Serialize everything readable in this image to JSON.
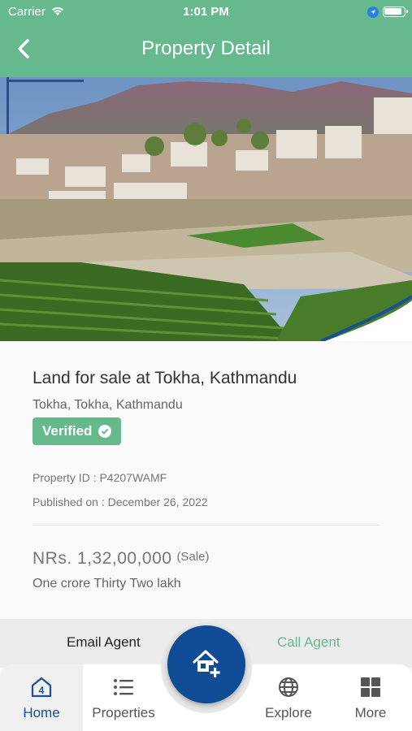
{
  "status_bar": {
    "carrier": "Carrier",
    "time": "1:01 PM"
  },
  "nav": {
    "title": "Property Detail"
  },
  "property": {
    "title": "Land for sale at Tokha, Kathmandu",
    "address": "Tokha, Tokha, Kathmandu",
    "verified_label": "Verified",
    "property_id": "Property ID : P4207WAMF",
    "published": "Published on : December 26, 2022",
    "price": "NRs. 1,32,00,000",
    "price_type": "(Sale)",
    "price_words": "One crore Thirty Two lakh"
  },
  "actions": {
    "email": "Email Agent",
    "call": "Call Agent"
  },
  "tabs": [
    {
      "label": "Home",
      "icon": "home-4-icon"
    },
    {
      "label": "Properties",
      "icon": "list-icon"
    },
    {
      "label": "Explore",
      "icon": "globe-icon"
    },
    {
      "label": "More",
      "icon": "grid-icon"
    }
  ],
  "colors": {
    "brand_green": "#66b98c",
    "brand_blue": "#0f4c95"
  }
}
